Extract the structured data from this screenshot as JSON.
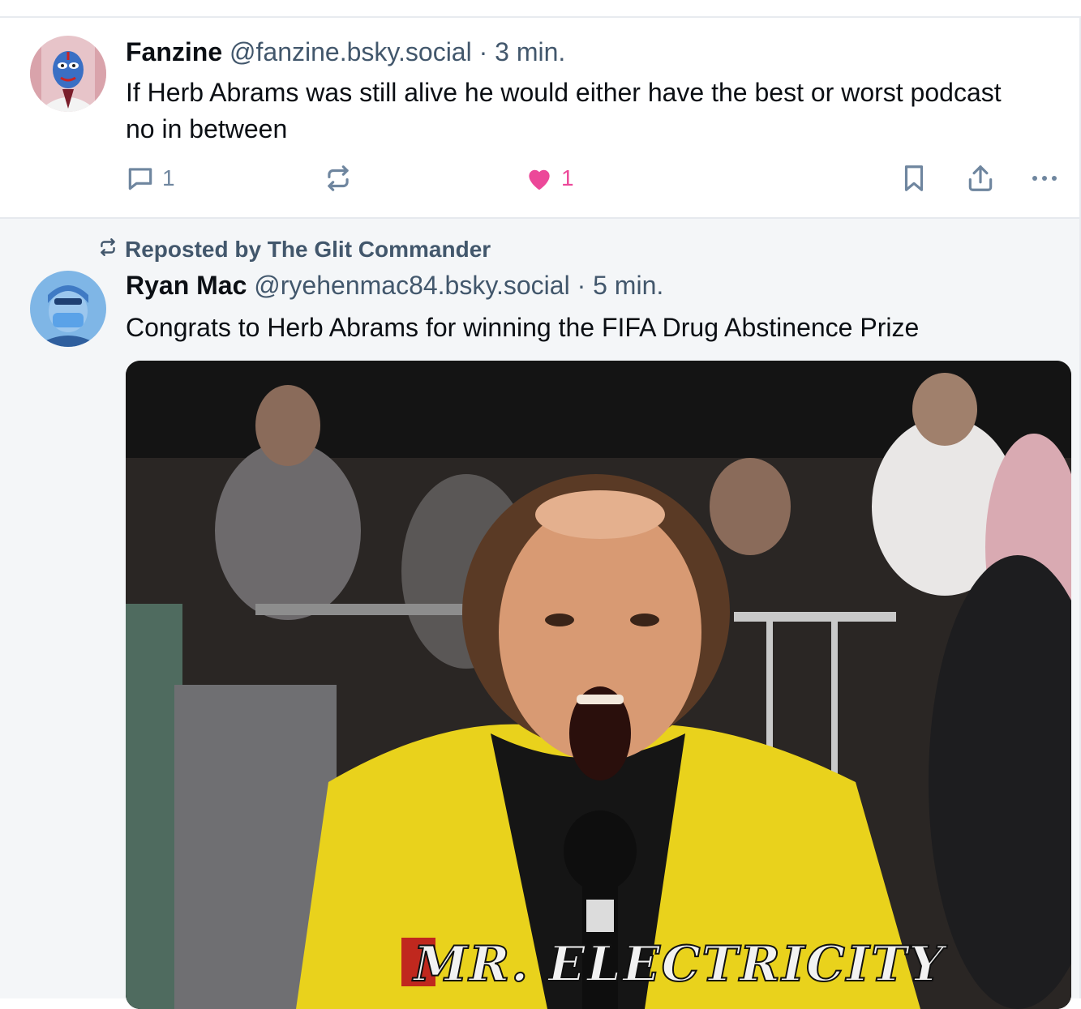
{
  "post1": {
    "author_name": "Fanzine",
    "handle": "@fanzine.bsky.social",
    "separator": "·",
    "time": "3 min.",
    "text": "If Herb Abrams was still alive he would either have the best or worst podcast no in between",
    "reply_count": "1",
    "like_count": "1",
    "liked": true
  },
  "post2": {
    "repost_label": "Reposted by The Glit Commander",
    "author_name": "Ryan Mac",
    "handle": "@ryehenmac84.bsky.social",
    "separator": "·",
    "time": "5 min.",
    "text": "Congrats to Herb Abrams for winning the FIFA Drug Abstinence Prize",
    "image_caption": "MR. ELECTRICITY"
  },
  "icons": {
    "reply": "speech-bubble-icon",
    "repost": "repost-arrows-icon",
    "like": "heart-icon",
    "bookmark": "bookmark-icon",
    "share": "share-icon",
    "more": "more-dots-icon"
  },
  "colors": {
    "like_active": "#ec4899",
    "muted_text": "#42576c",
    "icon_gray": "#6f869f",
    "jacket_yellow": "#e9d21c"
  }
}
